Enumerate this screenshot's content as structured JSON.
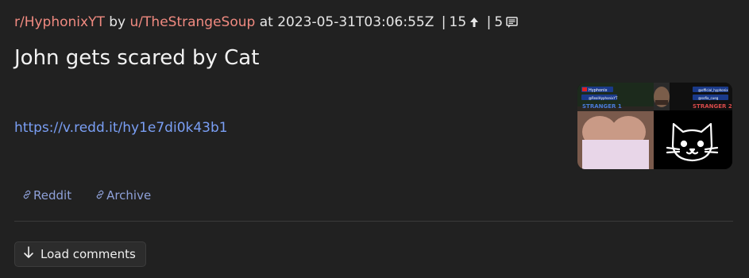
{
  "post": {
    "subreddit": "r/HyphonixYT",
    "by_text": "by",
    "author": "u/TheStrangeSoup",
    "at_text": "at",
    "timestamp": "2023-05-31T03:06:55Z",
    "separator": "|",
    "score": "15",
    "comments_count": "5",
    "title": "John gets scared by Cat",
    "url": "https://v.redd.it/hy1e7di0k43b1"
  },
  "thumbnail": {
    "left_label": "STRANGER 1",
    "right_label": "STRANGER 2",
    "badge_1": "Hyphonix",
    "badge_2": "@RealHyphonixYT",
    "badge_3": "@official_hyphonix",
    "badge_4": "@sofia_cueg"
  },
  "actions": {
    "reddit_label": "Reddit",
    "archive_label": "Archive"
  },
  "comments": {
    "load_label": "Load comments"
  },
  "colors": {
    "background": "#212121",
    "link_red": "#f08a80",
    "link_blue": "#7a9ff5",
    "action_blue": "#8ea0d8"
  }
}
